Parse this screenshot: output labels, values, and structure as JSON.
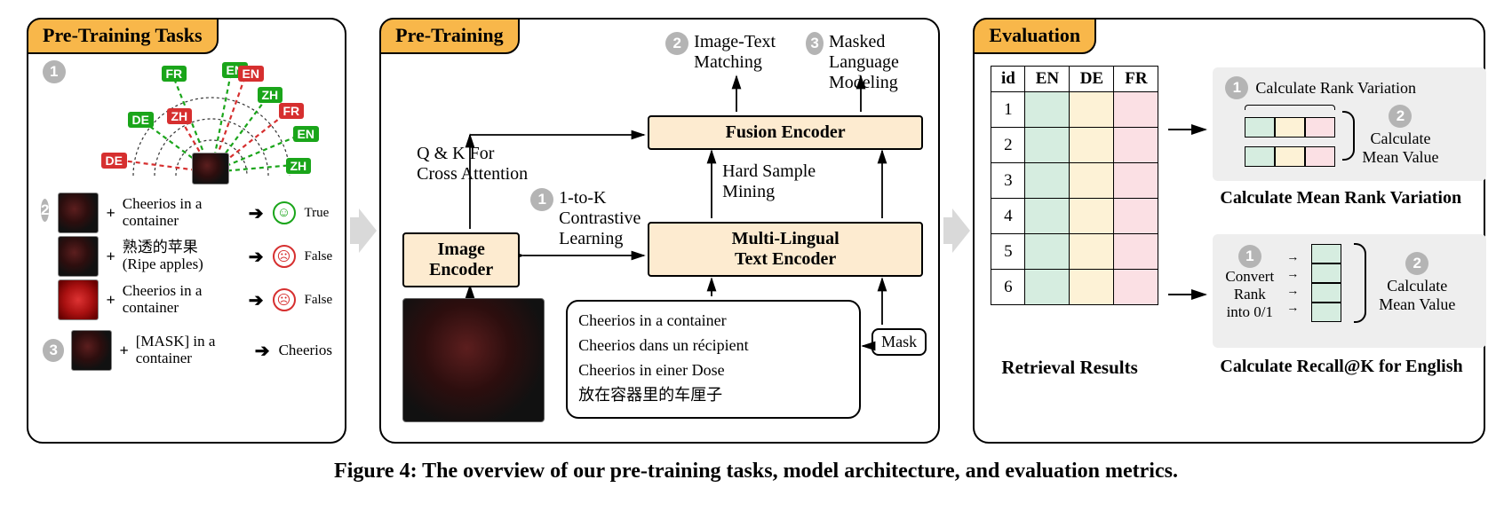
{
  "figure_caption": "Figure 4: The overview of our pre-training tasks, model architecture, and evaluation metrics.",
  "panel1": {
    "title": "Pre-Training Tasks",
    "langs_green": [
      "FR",
      "EN",
      "DE",
      "ZH",
      "EN",
      "ZH"
    ],
    "langs_red": [
      "DE",
      "ZH",
      "EN",
      "FR"
    ],
    "rows": [
      {
        "text": "Cheerios in a container",
        "verdict": "True",
        "happy": true,
        "img": "cherries"
      },
      {
        "text": "熟透的苹果\n(Ripe apples)",
        "verdict": "False",
        "happy": false,
        "img": "cherries"
      },
      {
        "text": "Cheerios in a container",
        "verdict": "False",
        "happy": false,
        "img": "apples"
      },
      {
        "text": "[MASK] in a container",
        "verdict": "Cheerios",
        "happy": null,
        "img": "cherries"
      }
    ]
  },
  "panel2": {
    "title": "Pre-Training",
    "labels": {
      "qk": "Q & K For\nCross Attention",
      "cl": "1-to-K\nContrastive\nLearning",
      "hsm": "Hard Sample\nMining",
      "itm": "Image-Text\nMatching",
      "mlm": "Masked\nLanguage Modeling",
      "img_enc": "Image\nEncoder",
      "txt_enc": "Multi-Lingual\nText Encoder",
      "fus_enc": "Fusion Encoder",
      "mask": "Mask"
    },
    "samples": [
      "Cheerios in a container",
      "Cheerios dans un récipient",
      "Cheerios in einer Dose",
      "放在容器里的车厘子"
    ]
  },
  "panel3": {
    "title": "Evaluation",
    "cols": [
      "id",
      "EN",
      "DE",
      "FR"
    ],
    "ids": [
      1,
      2,
      3,
      4,
      5,
      6
    ],
    "retrieval_label": "Retrieval Results",
    "calc1": {
      "step1": "Calculate Rank Variation",
      "step2": "Calculate\nMean Value",
      "title": "Calculate Mean Rank Variation"
    },
    "calc2": {
      "step1": "Convert\nRank\ninto 0/1",
      "step2": "Calculate\nMean Value",
      "title": "Calculate Recall@K for English"
    }
  }
}
